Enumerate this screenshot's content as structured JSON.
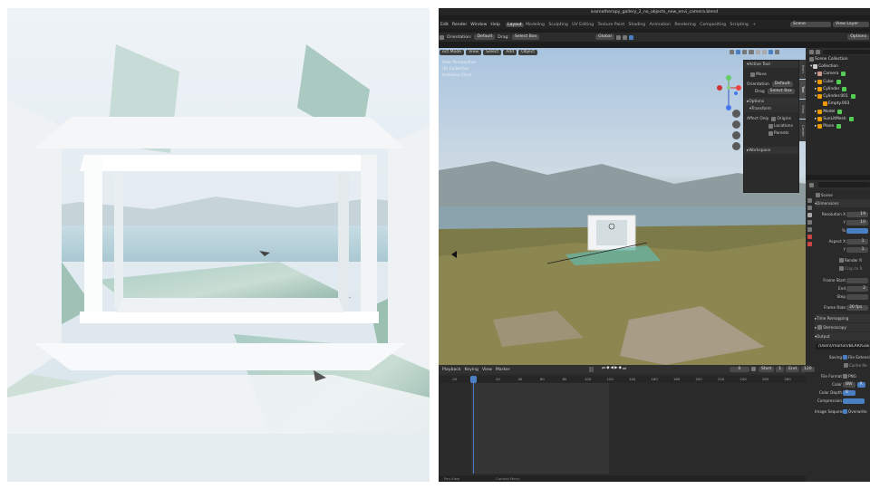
{
  "window": {
    "title": "aromatherapy_gallery_2_no_objects_new_envi_camera.blend"
  },
  "menu": [
    "Edit",
    "Render",
    "Window",
    "Help"
  ],
  "workspaces": [
    {
      "label": "Layout",
      "active": true
    },
    {
      "label": "Modeling"
    },
    {
      "label": "Sculpting"
    },
    {
      "label": "UV Editing"
    },
    {
      "label": "Texture Paint"
    },
    {
      "label": "Shading"
    },
    {
      "label": "Animation"
    },
    {
      "label": "Rendering"
    },
    {
      "label": "Compositing"
    },
    {
      "label": "Scripting"
    },
    {
      "label": "+"
    }
  ],
  "topright": {
    "scene": "Scene",
    "view_layer": "View Layer"
  },
  "tool_header": {
    "orientation_label": "Orientation:",
    "orientation_value": "Default",
    "drag_label": "Drag:",
    "drag_value": "Select Box",
    "transform_value": "Global",
    "options": "Options"
  },
  "viewport_header": {
    "mode": "ect Mode",
    "view": "View",
    "select": "Select",
    "add": "Add",
    "object": "Object"
  },
  "viewport_overlay_text": [
    "User Perspective",
    "(0) Collection",
    "Indexing Clock"
  ],
  "npanel": {
    "active_tool": "Active Tool",
    "move": "Move",
    "orientation_label": "Orientation",
    "orientation_value": "Default",
    "drag_label": "Drag",
    "drag_value": "Select Box",
    "options": "Options",
    "transform": "Transform",
    "affect_only": "Affect Only",
    "origins": "Origins",
    "locations": "Locations",
    "parents": "Parents",
    "workspace": "Workspace",
    "tabs": [
      "Item",
      "Tool",
      "View",
      "Create"
    ]
  },
  "outliner": {
    "header": "Scene Collection",
    "items": [
      {
        "label": "Collection",
        "depth": 0
      },
      {
        "label": "Camera",
        "depth": 1
      },
      {
        "label": "Cube",
        "depth": 1
      },
      {
        "label": "Cylinder",
        "depth": 1
      },
      {
        "label": "Cylinder.001",
        "depth": 1
      },
      {
        "label": "Empty.003",
        "depth": 2
      },
      {
        "label": "Model",
        "depth": 1
      },
      {
        "label": "SunLitMesh",
        "depth": 1
      },
      {
        "label": "Plane",
        "depth": 1
      }
    ]
  },
  "properties": {
    "scene": "Scene",
    "dimensions": "Dimensions",
    "rows": [
      {
        "label": "Resolution X",
        "value": "19"
      },
      {
        "label": "Y",
        "value": "10"
      },
      {
        "label": "%",
        "value": ""
      },
      {
        "label": "Aspect X",
        "value": "1."
      },
      {
        "label": "Y",
        "value": "1."
      },
      {
        "label": "",
        "value": "Render R"
      },
      {
        "label": "",
        "value": "Crop to R"
      },
      {
        "label": "Frame Start",
        "value": ""
      },
      {
        "label": "End",
        "value": "2"
      },
      {
        "label": "Step",
        "value": ""
      },
      {
        "label": "Frame Rate",
        "value": "30 fps"
      }
    ],
    "time_remapping": "Time Remapping",
    "stereoscopy": "Stereoscopy",
    "output": "Output",
    "output_path": "/Users/marlon/BLAR/Galler",
    "saving_label": "Saving",
    "file_extensions": "File Extensi",
    "cache_result": "Cache Re",
    "file_format_label": "File Format",
    "file_format_value": "PNG",
    "color_label": "Color",
    "color_bw": "BW",
    "color_r": "R",
    "color_depth_label": "Color Depth",
    "color_depth_value": "8",
    "compression_label": "Compression",
    "compression_value": "",
    "image_sequence_label": "Image Sequence",
    "overwrite": "Overwrite"
  },
  "timeline": {
    "menu": [
      "Playback",
      "Keying",
      "View",
      "Marker"
    ],
    "current_frame": "0",
    "start_label": "Start",
    "start": "1",
    "end_label": "End",
    "end": "120",
    "ruler": [
      "-20",
      "0",
      "20",
      "40",
      "60",
      "80",
      "100",
      "120",
      "140",
      "160",
      "180",
      "200",
      "220",
      "240",
      "260",
      "280"
    ]
  },
  "statusbar": [
    "Pan View",
    "Context Menu"
  ]
}
